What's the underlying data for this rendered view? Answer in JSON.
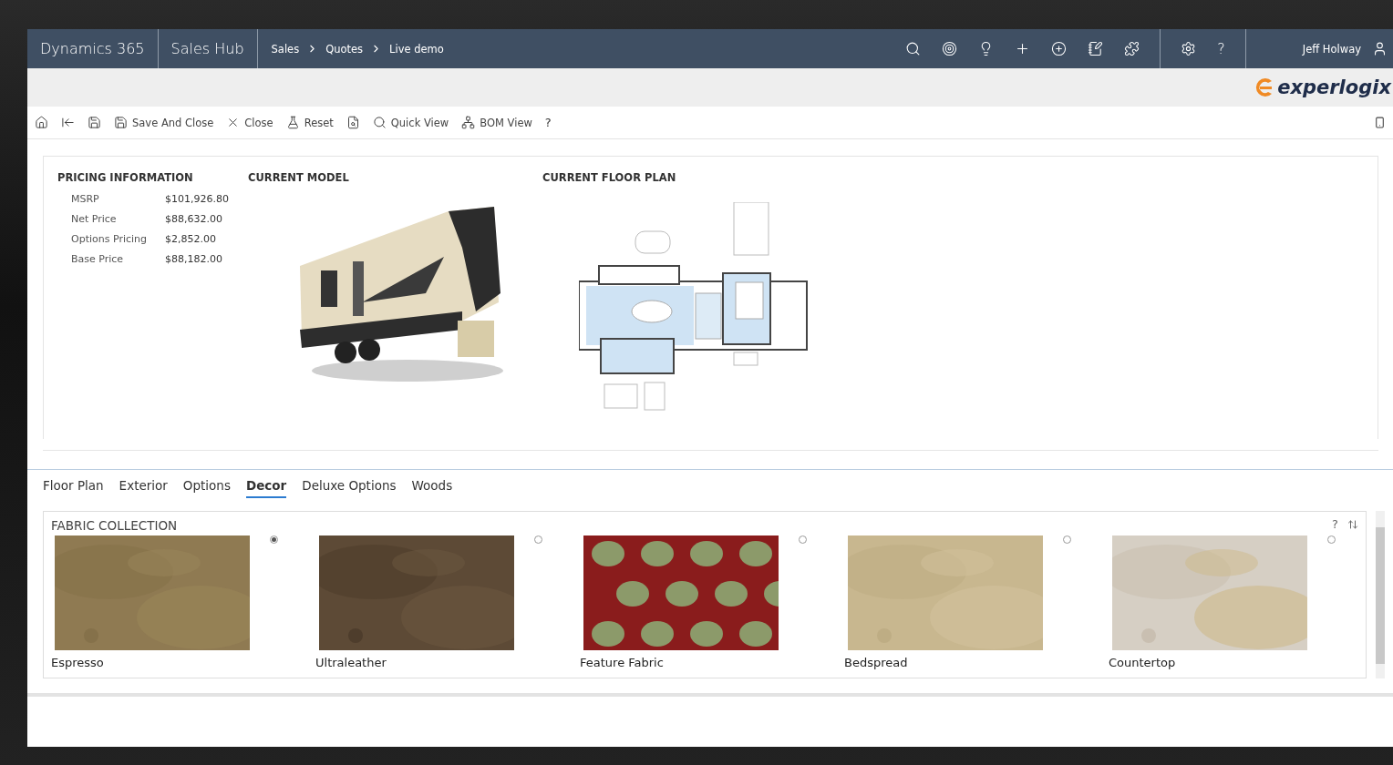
{
  "header": {
    "app": "Dynamics 365",
    "area": "Sales Hub",
    "breadcrumb": [
      "Sales",
      "Quotes",
      "Live demo"
    ],
    "help": "?",
    "user": "Jeff Holway"
  },
  "brand": {
    "logo": "experlogix"
  },
  "toolbar": {
    "items": [
      {
        "label": "Save And Close"
      },
      {
        "label": "Close"
      },
      {
        "label": "Reset"
      },
      {
        "label": "Quick View"
      },
      {
        "label": "BOM View"
      }
    ],
    "help": "?"
  },
  "pricing": {
    "title": "PRICING INFORMATION",
    "rows": [
      {
        "label": "MSRP",
        "value": "$101,926.80"
      },
      {
        "label": "Net Price",
        "value": "$88,632.00"
      },
      {
        "label": "Options Pricing",
        "value": "$2,852.00"
      },
      {
        "label": "Base Price",
        "value": "$88,182.00"
      }
    ]
  },
  "model": {
    "title": "CURRENT MODEL"
  },
  "floor_plan": {
    "title": "CURRENT FLOOR PLAN"
  },
  "tabs": [
    {
      "label": "Floor Plan",
      "selected": false
    },
    {
      "label": "Exterior",
      "selected": false
    },
    {
      "label": "Options",
      "selected": false
    },
    {
      "label": "Decor",
      "selected": true
    },
    {
      "label": "Deluxe Options",
      "selected": false
    },
    {
      "label": "Woods",
      "selected": false
    }
  ],
  "fabric": {
    "title": "FABRIC COLLECTION",
    "help": "?",
    "items": [
      {
        "name": "Espresso",
        "selected": true
      },
      {
        "name": "Ultraleather",
        "selected": false
      },
      {
        "name": "Feature Fabric",
        "selected": false
      },
      {
        "name": "Bedspread",
        "selected": false
      },
      {
        "name": "Countertop",
        "selected": false
      }
    ]
  }
}
